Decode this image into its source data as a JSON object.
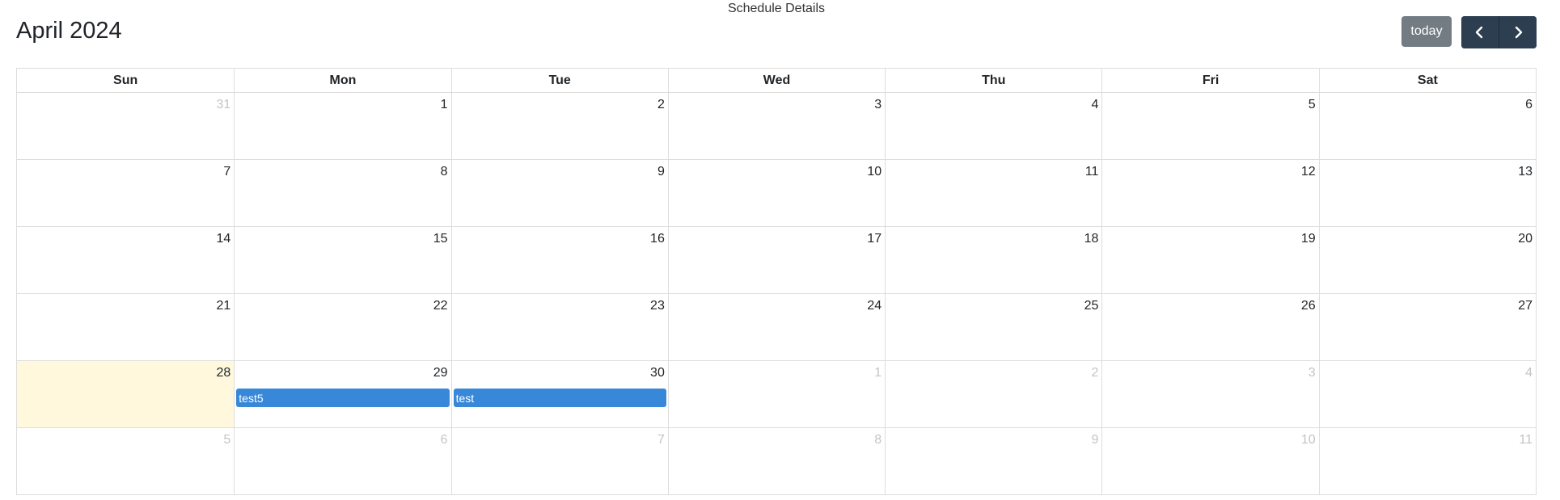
{
  "header": {
    "label": "Schedule Details"
  },
  "toolbar": {
    "title": "April 2024",
    "today_label": "today",
    "prev_icon": "chevron-left-icon",
    "next_icon": "chevron-right-icon",
    "today_button_color": "#6c757d",
    "nav_button_color": "#2c3e50"
  },
  "calendar": {
    "weekdays": [
      "Sun",
      "Mon",
      "Tue",
      "Wed",
      "Thu",
      "Fri",
      "Sat"
    ],
    "today_color": "#fff8dd",
    "event_color": "#3788d8",
    "weeks": [
      [
        {
          "day": "31",
          "other": true
        },
        {
          "day": "1"
        },
        {
          "day": "2"
        },
        {
          "day": "3"
        },
        {
          "day": "4"
        },
        {
          "day": "5"
        },
        {
          "day": "6"
        }
      ],
      [
        {
          "day": "7"
        },
        {
          "day": "8"
        },
        {
          "day": "9"
        },
        {
          "day": "10"
        },
        {
          "day": "11"
        },
        {
          "day": "12"
        },
        {
          "day": "13"
        }
      ],
      [
        {
          "day": "14"
        },
        {
          "day": "15"
        },
        {
          "day": "16"
        },
        {
          "day": "17"
        },
        {
          "day": "18"
        },
        {
          "day": "19"
        },
        {
          "day": "20"
        }
      ],
      [
        {
          "day": "21"
        },
        {
          "day": "22"
        },
        {
          "day": "23"
        },
        {
          "day": "24"
        },
        {
          "day": "25"
        },
        {
          "day": "26"
        },
        {
          "day": "27"
        }
      ],
      [
        {
          "day": "28",
          "today": true
        },
        {
          "day": "29",
          "event": "test5"
        },
        {
          "day": "30",
          "event": "test"
        },
        {
          "day": "1",
          "other": true
        },
        {
          "day": "2",
          "other": true
        },
        {
          "day": "3",
          "other": true
        },
        {
          "day": "4",
          "other": true
        }
      ],
      [
        {
          "day": "5",
          "other": true
        },
        {
          "day": "6",
          "other": true
        },
        {
          "day": "7",
          "other": true
        },
        {
          "day": "8",
          "other": true
        },
        {
          "day": "9",
          "other": true
        },
        {
          "day": "10",
          "other": true
        },
        {
          "day": "11",
          "other": true
        }
      ]
    ]
  }
}
